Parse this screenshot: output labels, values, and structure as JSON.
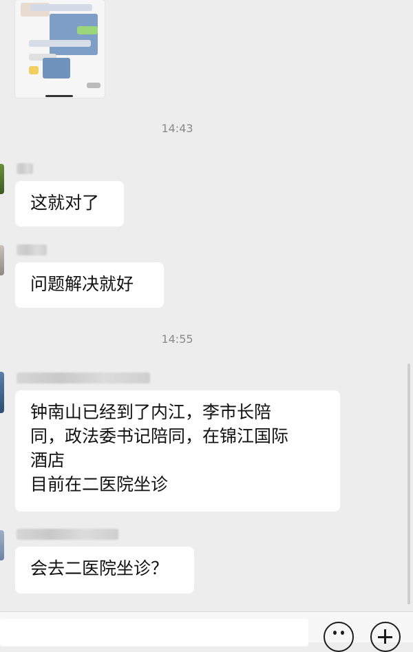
{
  "messages": {
    "timestamp_1": "14:43",
    "bubble_1": "这就对了",
    "bubble_2": "问题解决就好",
    "timestamp_2": "14:55",
    "bubble_3": "钟南山已经到了内江，李市长陪\n同，政法委书记陪同，在锦江国际\n酒店\n目前在二医院坐诊",
    "bubble_4": "会去二医院坐诊？"
  },
  "icons": {
    "emoji": "emoji-icon",
    "plus": "plus-icon"
  },
  "colors": {
    "background": "#ededed",
    "bubble": "#ffffff",
    "timestamp": "#8a8a8a"
  }
}
